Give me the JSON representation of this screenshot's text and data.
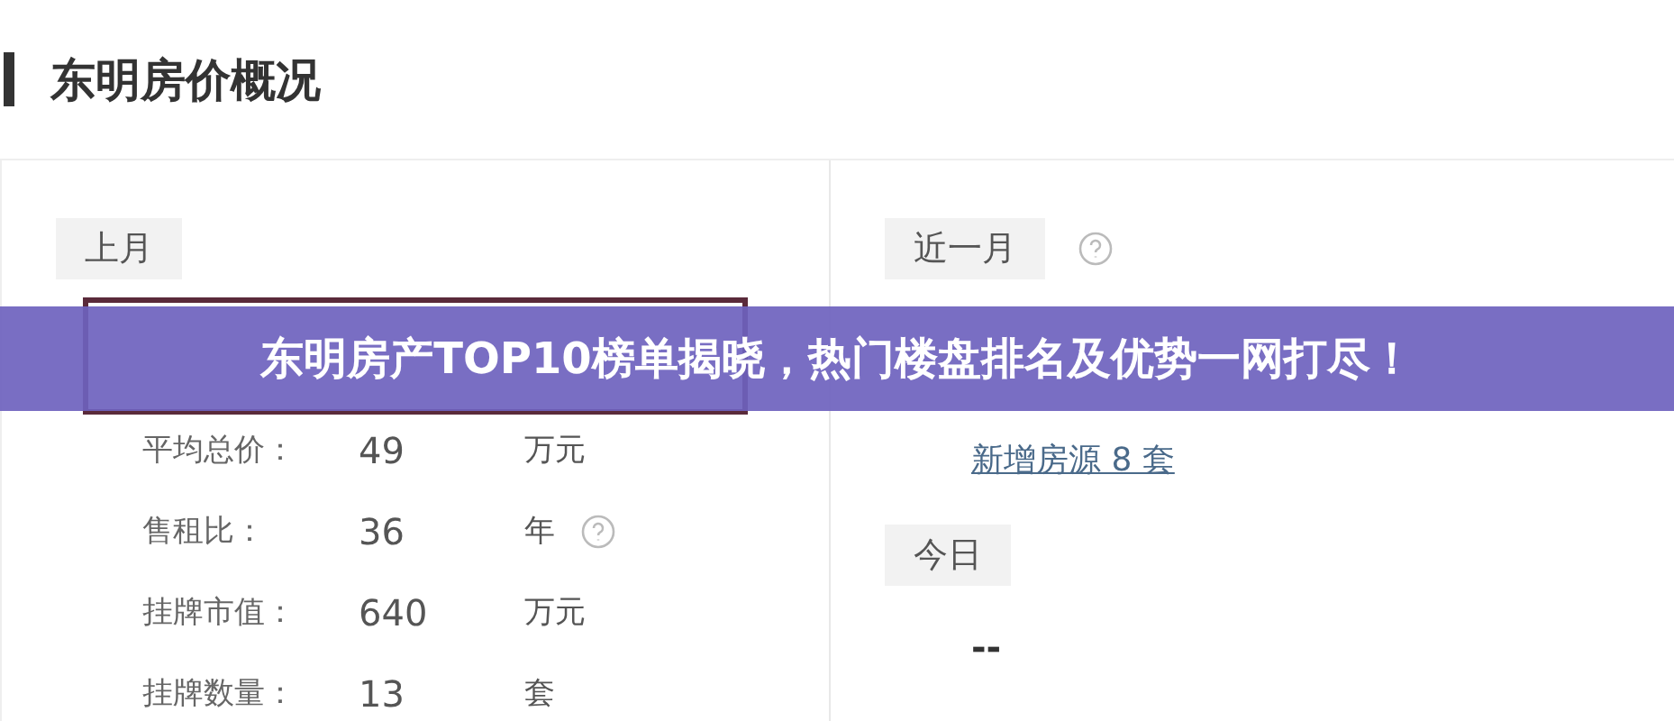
{
  "header": {
    "title": "东明房价概况"
  },
  "last_month": {
    "tag": "上月",
    "stats": [
      {
        "label": "平均总价：",
        "value": "49",
        "unit": "万元",
        "help": false
      },
      {
        "label": "售租比：",
        "value": "36",
        "unit": "年",
        "help": true
      },
      {
        "label": "挂牌市值：",
        "value": "640",
        "unit": "万元",
        "help": false
      },
      {
        "label": "挂牌数量：",
        "value": "13",
        "unit": "套",
        "help": false
      }
    ]
  },
  "recent_month": {
    "tag": "近一月",
    "help": true,
    "link": "新增房源 8 套"
  },
  "today": {
    "tag": "今日",
    "value": "--"
  },
  "banner": {
    "text": "东明房产TOP10榜单揭晓，热门楼盘排名及优势一网打尽！"
  }
}
